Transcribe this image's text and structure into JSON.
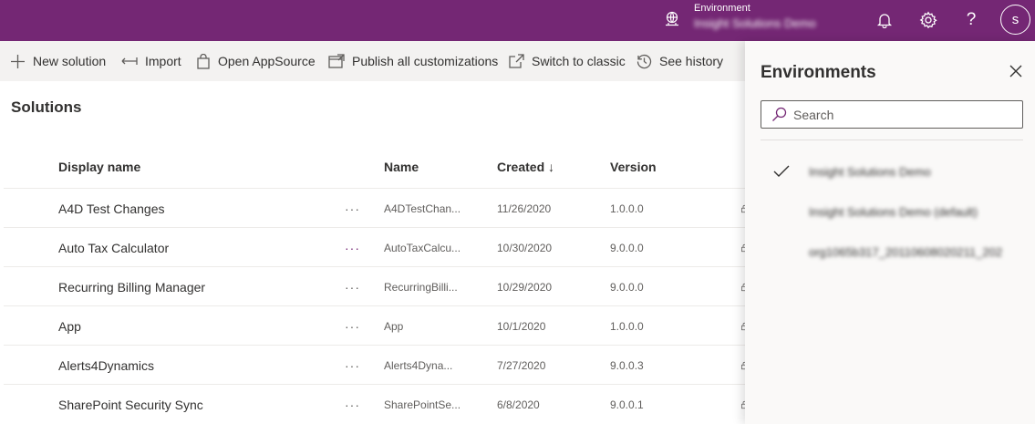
{
  "header": {
    "environment_label": "Environment",
    "environment_value": "Insight Solutions Demo",
    "avatar_initial": "s",
    "help_glyph": "?"
  },
  "commands": [
    {
      "label": "New solution",
      "icon": "plus-icon"
    },
    {
      "label": "Import",
      "icon": "import-icon"
    },
    {
      "label": "Open AppSource",
      "icon": "shopping-bag-icon"
    },
    {
      "label": "Publish all customizations",
      "icon": "publish-icon"
    },
    {
      "label": "Switch to classic",
      "icon": "open-in-new-icon"
    },
    {
      "label": "See history",
      "icon": "history-icon"
    }
  ],
  "main": {
    "title": "Solutions",
    "columns": {
      "display_name": "Display name",
      "name": "Name",
      "created": "Created",
      "created_sort": "↓",
      "version": "Version"
    },
    "rows": [
      {
        "display_name": "A4D Test Changes",
        "more": "···",
        "name": "A4DTestChan...",
        "created": "11/26/2020",
        "version": "1.0.0.0"
      },
      {
        "display_name": "Auto Tax Calculator",
        "more": "···",
        "name": "AutoTaxCalcu...",
        "created": "10/30/2020",
        "version": "9.0.0.0"
      },
      {
        "display_name": "Recurring Billing Manager",
        "more": "···",
        "name": "RecurringBilli...",
        "created": "10/29/2020",
        "version": "9.0.0.0"
      },
      {
        "display_name": "App",
        "more": "···",
        "name": "App",
        "created": "10/1/2020",
        "version": "1.0.0.0"
      },
      {
        "display_name": "Alerts4Dynamics",
        "more": "···",
        "name": "Alerts4Dyna...",
        "created": "7/27/2020",
        "version": "9.0.0.3"
      },
      {
        "display_name": "SharePoint Security Sync",
        "more": "···",
        "name": "SharePointSe...",
        "created": "6/8/2020",
        "version": "9.0.0.1"
      }
    ]
  },
  "panel": {
    "title": "Environments",
    "search_placeholder": "Search",
    "environments": [
      {
        "name": "Insight Solutions Demo",
        "selected": true
      },
      {
        "name": "Insight Solutions Demo (default)",
        "selected": false
      },
      {
        "name": "org1065b317_20110608020211_202",
        "selected": false
      }
    ]
  },
  "colors": {
    "header_bg": "#742774",
    "command_bar_bg": "#f3f2f1",
    "panel_bg": "#faf9f8",
    "accent": "#742774"
  }
}
